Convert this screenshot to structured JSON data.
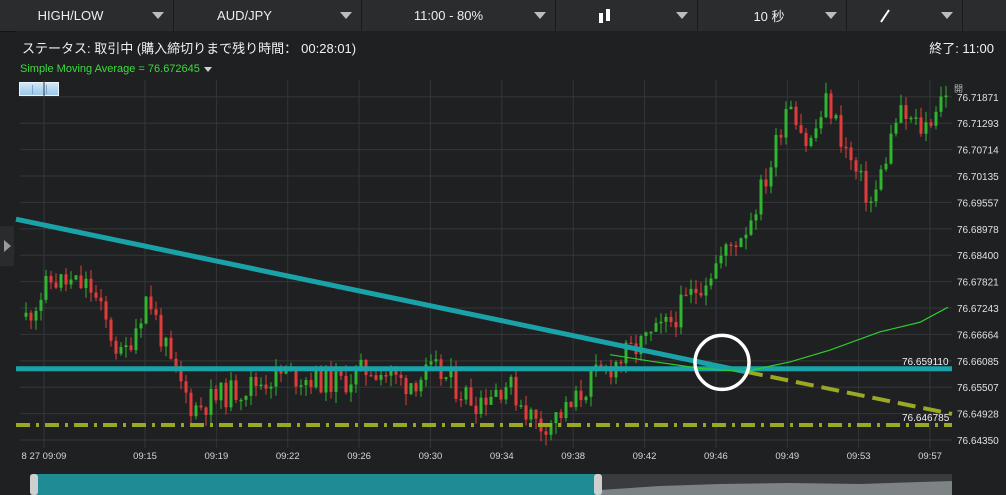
{
  "toolbar": {
    "type": "HIGH/LOW",
    "pair": "AUD/JPY",
    "expiry": "11:00 - 80%",
    "timeframe": "10 秒"
  },
  "status": {
    "label": "ステータス: 取引中 (購入締切りまで残り時間：",
    "remaining": "00:28:01)",
    "end": "終了: 11:00"
  },
  "indicator": {
    "label": "Simple Moving Average = 76.672645"
  },
  "colors": {
    "up": "#2fb52f",
    "down": "#e23b3b",
    "sma": "#2ecc2e",
    "trend": "#19a3a8",
    "support": "#9aa824",
    "circle": "#ffffff"
  },
  "chart_data": {
    "type": "candlestick",
    "y_ticks": [
      "76.71871",
      "76.71293",
      "76.70714",
      "76.70135",
      "76.69557",
      "76.68978",
      "76.68400",
      "76.67821",
      "76.67243",
      "76.66664",
      "76.66085",
      "76.65507",
      "76.64928",
      "76.64350"
    ],
    "x_ticks": [
      "8 27 09:09",
      "09:15",
      "09:19",
      "09:22",
      "09:26",
      "09:30",
      "09:34",
      "09:38",
      "09:42",
      "09:46",
      "09:49",
      "09:53",
      "09:57"
    ],
    "price_labels": {
      "horizontal_line": "76.659110",
      "support_line": "76.646785"
    },
    "open_marker": "開",
    "ylim": [
      76.6424,
      76.7224
    ],
    "sma_last": 76.672645
  }
}
